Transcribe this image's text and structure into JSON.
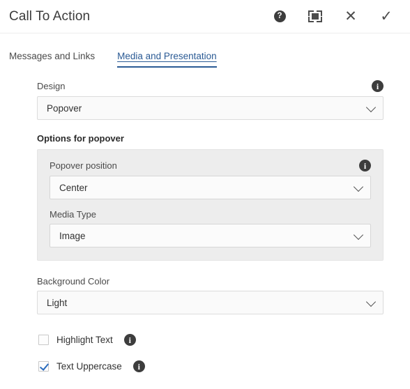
{
  "window": {
    "title": "Call To Action",
    "actions": [
      {
        "name": "help-icon",
        "label": "?"
      },
      {
        "name": "fullscreen-icon",
        "label": ""
      },
      {
        "name": "close-icon",
        "label": "✕"
      },
      {
        "name": "confirm-icon",
        "label": "✓"
      }
    ]
  },
  "tabs": [
    {
      "label": "Messages and Links",
      "active": false
    },
    {
      "label": "Media and Presentation",
      "active": true
    }
  ],
  "form": {
    "design": {
      "label": "Design",
      "value": "Popover",
      "info_icon": "i"
    },
    "options_group": {
      "heading": "Options for popover",
      "popover_position": {
        "label": "Popover position",
        "value": "Center",
        "info_icon": "i"
      },
      "media_type": {
        "label": "Media Type",
        "value": "Image"
      }
    },
    "background_color": {
      "label": "Background Color",
      "value": "Light"
    },
    "checkboxes": [
      {
        "label": "Highlight Text",
        "checked": false,
        "info_icon": "i"
      },
      {
        "label": "Text Uppercase",
        "checked": true,
        "info_icon": "i"
      }
    ]
  },
  "colors": {
    "accent": "#2a5a94",
    "check": "#2a6bbd",
    "panel": "#ededed",
    "text": "#333333"
  }
}
